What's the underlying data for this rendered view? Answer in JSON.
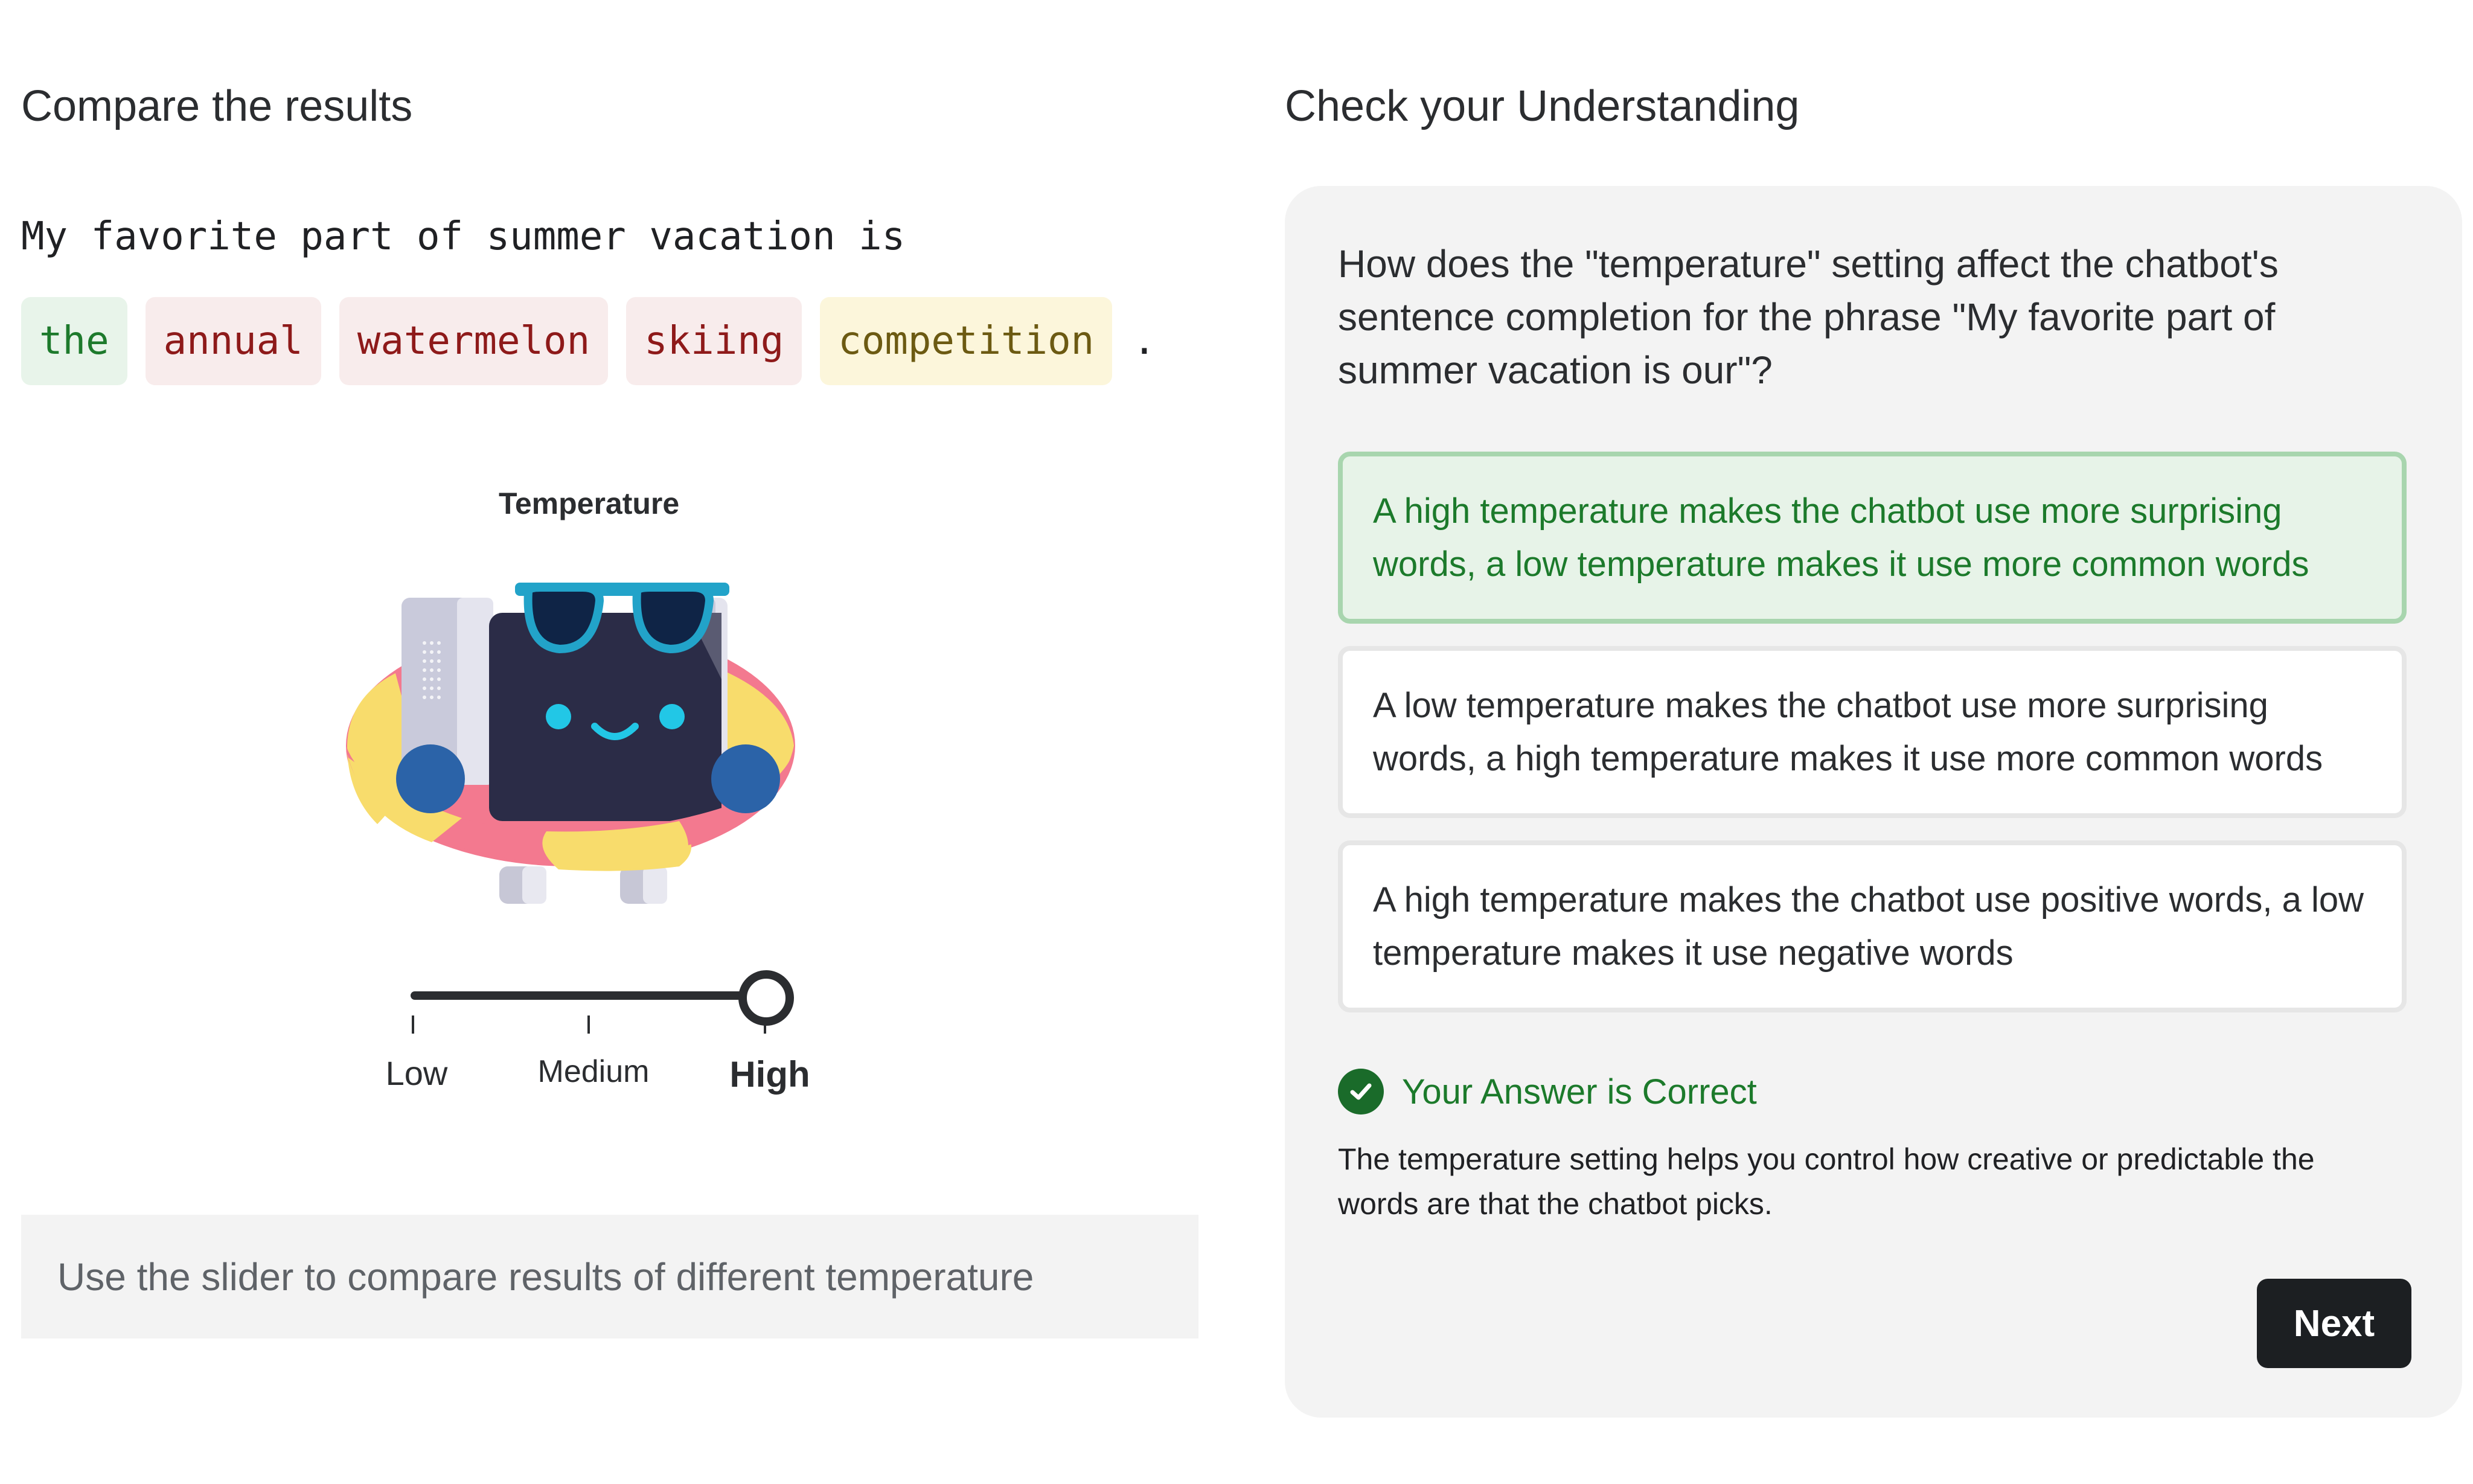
{
  "left_panel": {
    "title": "Compare the results",
    "prompt": "My favorite part of summer vacation is",
    "tokens": [
      {
        "text": "the",
        "color": "green"
      },
      {
        "text": "annual",
        "color": "red"
      },
      {
        "text": "watermelon",
        "color": "red"
      },
      {
        "text": "skiing",
        "color": "red"
      },
      {
        "text": "competition",
        "color": "yellow"
      }
    ],
    "sentence_end": ".",
    "temperature_label": "Temperature",
    "slider": {
      "labels": [
        "Low",
        "Medium",
        "High"
      ],
      "selected": "High",
      "value": 1.0
    },
    "hint": "Use the slider to compare results of different temperature"
  },
  "right_panel": {
    "title": "Check your Understanding",
    "question": "How does the \"temperature\" setting affect the chatbot's sentence completion for the phrase \"My favorite part of summer vacation is our\"?",
    "options": [
      {
        "text": "A high temperature makes the chatbot use more surprising words, a low temperature makes it use more common words",
        "selected": true
      },
      {
        "text": "A low temperature makes the chatbot use more surprising words, a high temperature makes it use more common words",
        "selected": false
      },
      {
        "text": "A high temperature makes the chatbot use positive words, a low temperature makes it use negative words",
        "selected": false
      }
    ],
    "result": {
      "icon": "check-circle-icon",
      "text": "Your Answer is Correct"
    },
    "explanation": "The temperature setting helps you control how creative or predictable the words are that the chatbot picks.",
    "next_label": "Next"
  },
  "colors": {
    "correct_green": "#1c7a2b",
    "selected_bg": "#e7f3e8",
    "token_red": "#8e1a1a",
    "token_yellow": "#6c5a12",
    "button_dark": "#1c1f22"
  }
}
